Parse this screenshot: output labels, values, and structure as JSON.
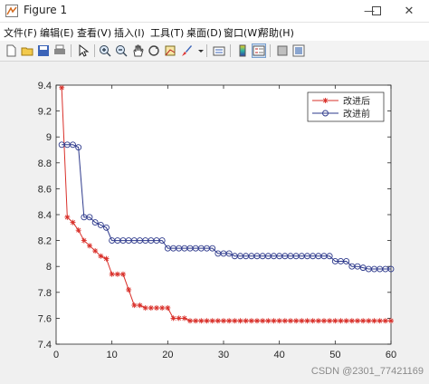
{
  "window": {
    "title": "Figure 1",
    "controls": {
      "minimize": "—",
      "maximize": "☐",
      "close": "✕"
    }
  },
  "menu": {
    "items": [
      "文件(F)",
      "编辑(E)",
      "查看(V)",
      "插入(I)",
      "工具(T)",
      "桌面(D)",
      "窗口(W)",
      "帮助(H)"
    ]
  },
  "toolbar": {
    "icons": [
      "new-figure-icon",
      "open-file-icon",
      "save-icon",
      "print-icon",
      "edit-plot-arrow-icon",
      "zoom-in-icon",
      "zoom-out-icon",
      "pan-hand-icon",
      "rotate-3d-icon",
      "data-cursor-icon",
      "brush-icon",
      "link-plot-icon",
      "colorbar-icon",
      "legend-icon",
      "hide-plot-tools-icon",
      "show-plot-tools-icon"
    ]
  },
  "watermark": "CSDN @2301_77421169",
  "chart_data": {
    "type": "line",
    "xlim": [
      0,
      60
    ],
    "ylim": [
      7.4,
      9.4
    ],
    "xticks": [
      "0",
      "10",
      "20",
      "30",
      "40",
      "50",
      "60"
    ],
    "yticks": [
      "7.4",
      "7.6",
      "7.8",
      "8",
      "8.2",
      "8.4",
      "8.6",
      "8.8",
      "9",
      "9.2",
      "9.4"
    ],
    "grid": false,
    "legend_position": "top-right",
    "x": [
      1,
      2,
      3,
      4,
      5,
      6,
      7,
      8,
      9,
      10,
      11,
      12,
      13,
      14,
      15,
      16,
      17,
      18,
      19,
      20,
      21,
      22,
      23,
      24,
      25,
      26,
      27,
      28,
      29,
      30,
      31,
      32,
      33,
      34,
      35,
      36,
      37,
      38,
      39,
      40,
      41,
      42,
      43,
      44,
      45,
      46,
      47,
      48,
      49,
      50,
      51,
      52,
      53,
      54,
      55,
      56,
      57,
      58,
      59,
      60
    ],
    "series": [
      {
        "name": "改进后",
        "color": "#d9302a",
        "marker": "star",
        "values": [
          9.38,
          8.38,
          8.34,
          8.28,
          8.2,
          8.16,
          8.12,
          8.08,
          8.06,
          7.94,
          7.94,
          7.94,
          7.82,
          7.7,
          7.7,
          7.68,
          7.68,
          7.68,
          7.68,
          7.68,
          7.6,
          7.6,
          7.6,
          7.58,
          7.58,
          7.58,
          7.58,
          7.58,
          7.58,
          7.58,
          7.58,
          7.58,
          7.58,
          7.58,
          7.58,
          7.58,
          7.58,
          7.58,
          7.58,
          7.58,
          7.58,
          7.58,
          7.58,
          7.58,
          7.58,
          7.58,
          7.58,
          7.58,
          7.58,
          7.58,
          7.58,
          7.58,
          7.58,
          7.58,
          7.58,
          7.58,
          7.58,
          7.58,
          7.58,
          7.58
        ]
      },
      {
        "name": "改进前",
        "color": "#2e3a8c",
        "marker": "circle",
        "values": [
          8.94,
          8.94,
          8.94,
          8.92,
          8.38,
          8.38,
          8.34,
          8.32,
          8.3,
          8.2,
          8.2,
          8.2,
          8.2,
          8.2,
          8.2,
          8.2,
          8.2,
          8.2,
          8.2,
          8.14,
          8.14,
          8.14,
          8.14,
          8.14,
          8.14,
          8.14,
          8.14,
          8.14,
          8.1,
          8.1,
          8.1,
          8.08,
          8.08,
          8.08,
          8.08,
          8.08,
          8.08,
          8.08,
          8.08,
          8.08,
          8.08,
          8.08,
          8.08,
          8.08,
          8.08,
          8.08,
          8.08,
          8.08,
          8.08,
          8.04,
          8.04,
          8.04,
          8.0,
          8.0,
          7.99,
          7.98,
          7.98,
          7.98,
          7.98,
          7.98
        ]
      }
    ]
  }
}
